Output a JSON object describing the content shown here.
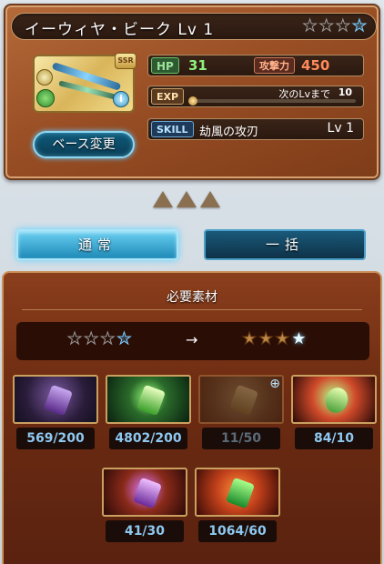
{
  "weapon": {
    "name": "イーウィヤ・ビーク Lv 1",
    "rarity_badge": "SSR",
    "info_badge": "i",
    "base_change_label": "ベース変更",
    "hp_label": "HP",
    "hp_value": "31",
    "atk_label": "攻撃力",
    "atk_value": "450",
    "exp_label": "EXP",
    "next_level_label": "次のLvまで",
    "next_level_value": "10",
    "exp_progress": 0.0,
    "skill_label": "SKILL",
    "skill_name": "劫風の攻刃",
    "skill_level": "Lv 1",
    "uncap_stars_total": 4,
    "uncap_stars_filled": 0
  },
  "modes": {
    "normal_label": "通常",
    "bulk_label": "一括"
  },
  "materials_panel": {
    "title": "必要素材",
    "arrow": "→",
    "from_stars": [
      "empty",
      "empty",
      "empty",
      "blue"
    ],
    "to_stars": [
      "gold",
      "gold",
      "gold",
      "bright"
    ],
    "items": [
      {
        "name": "purple-crystal",
        "count": "569/200"
      },
      {
        "name": "green-crystal",
        "count": "4802/200"
      },
      {
        "name": "wind-crystal-dim",
        "count": "11/50"
      },
      {
        "name": "wind-emblem",
        "count": "84/10"
      },
      {
        "name": "purple-shard",
        "count": "41/30"
      },
      {
        "name": "green-shard",
        "count": "1064/60"
      }
    ]
  },
  "colors": {
    "panel_bg": "#6e2c12",
    "accent_blue": "#1e8ab8",
    "count_text": "#8ec8f0"
  }
}
